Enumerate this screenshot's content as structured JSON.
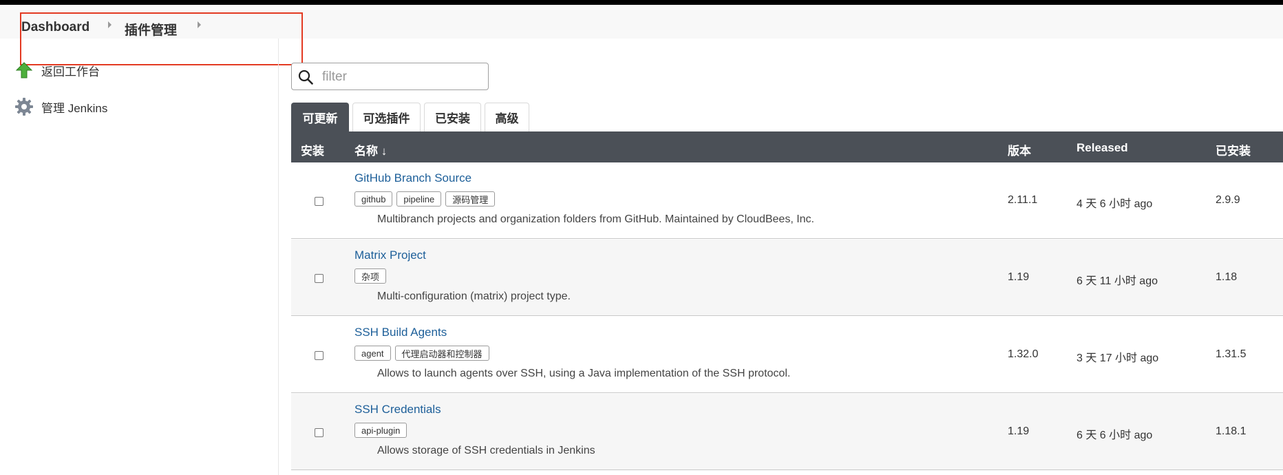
{
  "breadcrumb": {
    "items": [
      "Dashboard",
      "插件管理"
    ]
  },
  "sidebar": {
    "items": [
      {
        "label": "返回工作台",
        "icon": "up-arrow-icon"
      },
      {
        "label": "管理 Jenkins",
        "icon": "gear-icon"
      }
    ]
  },
  "filter": {
    "placeholder": "filter",
    "value": ""
  },
  "tabs": [
    {
      "label": "可更新",
      "active": true
    },
    {
      "label": "可选插件",
      "active": false
    },
    {
      "label": "已安装",
      "active": false
    },
    {
      "label": "高级",
      "active": false
    }
  ],
  "table": {
    "headers": {
      "install": "安装",
      "name": "名称 ↓",
      "version": "版本",
      "released": "Released",
      "installed": "已安装"
    },
    "rows": [
      {
        "name": "GitHub Branch Source",
        "tags": [
          "github",
          "pipeline",
          "源码管理"
        ],
        "description": "Multibranch projects and organization folders from GitHub. Maintained by CloudBees, Inc.",
        "version": "2.11.1",
        "released": "4 天 6 小时 ago",
        "installed": "2.9.9"
      },
      {
        "name": "Matrix Project",
        "tags": [
          "杂项"
        ],
        "description": "Multi-configuration (matrix) project type.",
        "version": "1.19",
        "released": "6 天 11 小时 ago",
        "installed": "1.18"
      },
      {
        "name": "SSH Build Agents",
        "tags": [
          "agent",
          "代理启动器和控制器"
        ],
        "description": "Allows to launch agents over SSH, using a Java implementation of the SSH protocol.",
        "version": "1.32.0",
        "released": "3 天 17 小时 ago",
        "installed": "1.31.5"
      },
      {
        "name": "SSH Credentials",
        "tags": [
          "api-plugin"
        ],
        "description": "Allows storage of SSH credentials in Jenkins",
        "version": "1.19",
        "released": "6 天 6 小时 ago",
        "installed": "1.18.1"
      }
    ]
  },
  "colors": {
    "header_bg": "#4b5057",
    "link": "#1d5f99",
    "highlight_border": "#e33a22"
  }
}
